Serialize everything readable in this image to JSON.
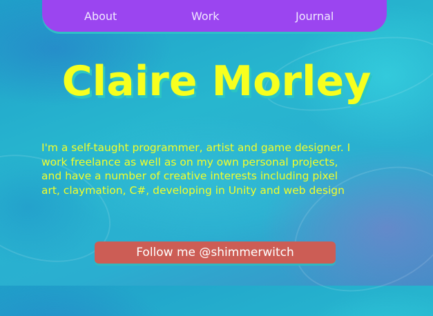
{
  "nav": {
    "items": [
      {
        "label": "About"
      },
      {
        "label": "Work"
      },
      {
        "label": "Journal"
      }
    ]
  },
  "hero": {
    "title": "Claire Morley"
  },
  "bio": {
    "lines": [
      "I'm a self-taught programmer, artist and game designer. I",
      "work freelance as well as on my own personal projects,",
      "and have a number of creative interests including pixel",
      "art, claymation, C#, developing in Unity and web design"
    ]
  },
  "follow_button": {
    "label": "Follow me @shimmerwitch"
  },
  "colors": {
    "nav_background": "#9b45f0",
    "title": "#f7ff1e",
    "button": "#cc5d55",
    "accent_shadow": "#2cc6c2"
  }
}
